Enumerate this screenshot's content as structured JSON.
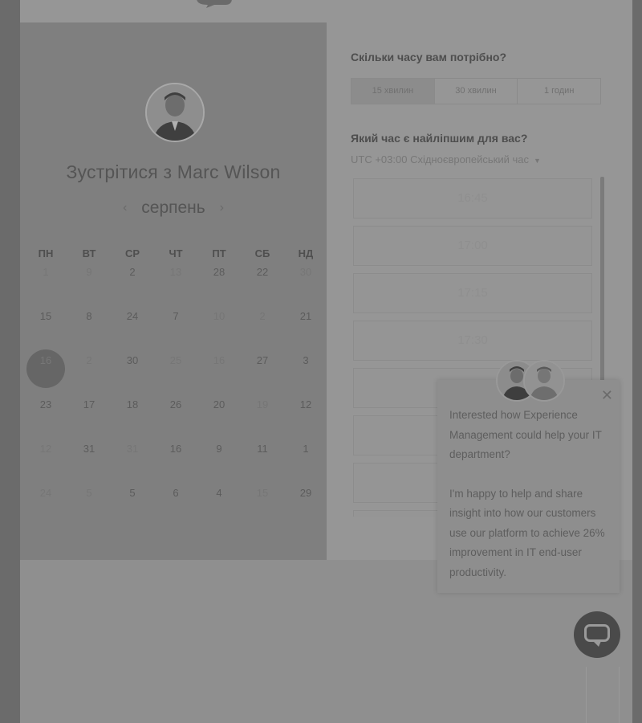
{
  "left": {
    "title": "Зустрітися з Marc Wilson",
    "month": "серпень",
    "prev_arrow": "‹",
    "next_arrow": "›",
    "weekdays": [
      "ПН",
      "ВТ",
      "СР",
      "ЧТ",
      "ПТ",
      "СБ",
      "НД"
    ],
    "weeks": [
      [
        {
          "d": "1",
          "f": true
        },
        {
          "d": "9",
          "f": true
        },
        {
          "d": "2",
          "f": false
        },
        {
          "d": "13",
          "f": true
        },
        {
          "d": "28",
          "f": false
        },
        {
          "d": "22",
          "f": false
        },
        {
          "d": "30",
          "f": true
        }
      ],
      [
        {
          "d": "15",
          "f": false
        },
        {
          "d": "8",
          "f": false
        },
        {
          "d": "24",
          "f": false
        },
        {
          "d": "7",
          "f": false
        },
        {
          "d": "10",
          "f": true
        },
        {
          "d": "2",
          "f": true
        },
        {
          "d": "21",
          "f": false
        }
      ],
      [
        {
          "d": "16",
          "f": false,
          "sel": true
        },
        {
          "d": "2",
          "f": true
        },
        {
          "d": "30",
          "f": false
        },
        {
          "d": "25",
          "f": true
        },
        {
          "d": "16",
          "f": true
        },
        {
          "d": "27",
          "f": false
        },
        {
          "d": "3",
          "f": false
        }
      ],
      [
        {
          "d": "23",
          "f": false
        },
        {
          "d": "17",
          "f": false
        },
        {
          "d": "18",
          "f": false
        },
        {
          "d": "26",
          "f": false
        },
        {
          "d": "20",
          "f": false
        },
        {
          "d": "19",
          "f": true
        },
        {
          "d": "12",
          "f": false
        }
      ],
      [
        {
          "d": "12",
          "f": true
        },
        {
          "d": "31",
          "f": false
        },
        {
          "d": "31",
          "f": true
        },
        {
          "d": "16",
          "f": false
        },
        {
          "d": "9",
          "f": false
        },
        {
          "d": "11",
          "f": false
        },
        {
          "d": "1",
          "f": false
        }
      ],
      [
        {
          "d": "24",
          "f": true
        },
        {
          "d": "5",
          "f": true
        },
        {
          "d": "5",
          "f": false
        },
        {
          "d": "6",
          "f": false
        },
        {
          "d": "4",
          "f": false
        },
        {
          "d": "15",
          "f": true
        },
        {
          "d": "29",
          "f": false
        }
      ]
    ]
  },
  "right": {
    "duration_question": "Скільки часу вам потрібно?",
    "durations": [
      "15 хвилин",
      "30 хвилин",
      "1 годин"
    ],
    "time_question": "Який час є найліпшим для вас?",
    "timezone": "UTC +03:00 Східноєвропейський час",
    "slots": [
      "16:45",
      "17:00",
      "17:15",
      "17:30",
      "",
      "",
      "",
      ""
    ]
  },
  "chat": {
    "close": "✕",
    "message_1": "Interested how Experience Management could help your IT department?",
    "message_2": "I'm happy to help and share insight into how our customers use our platform to achieve 26% improvement in IT end-user productivity."
  }
}
